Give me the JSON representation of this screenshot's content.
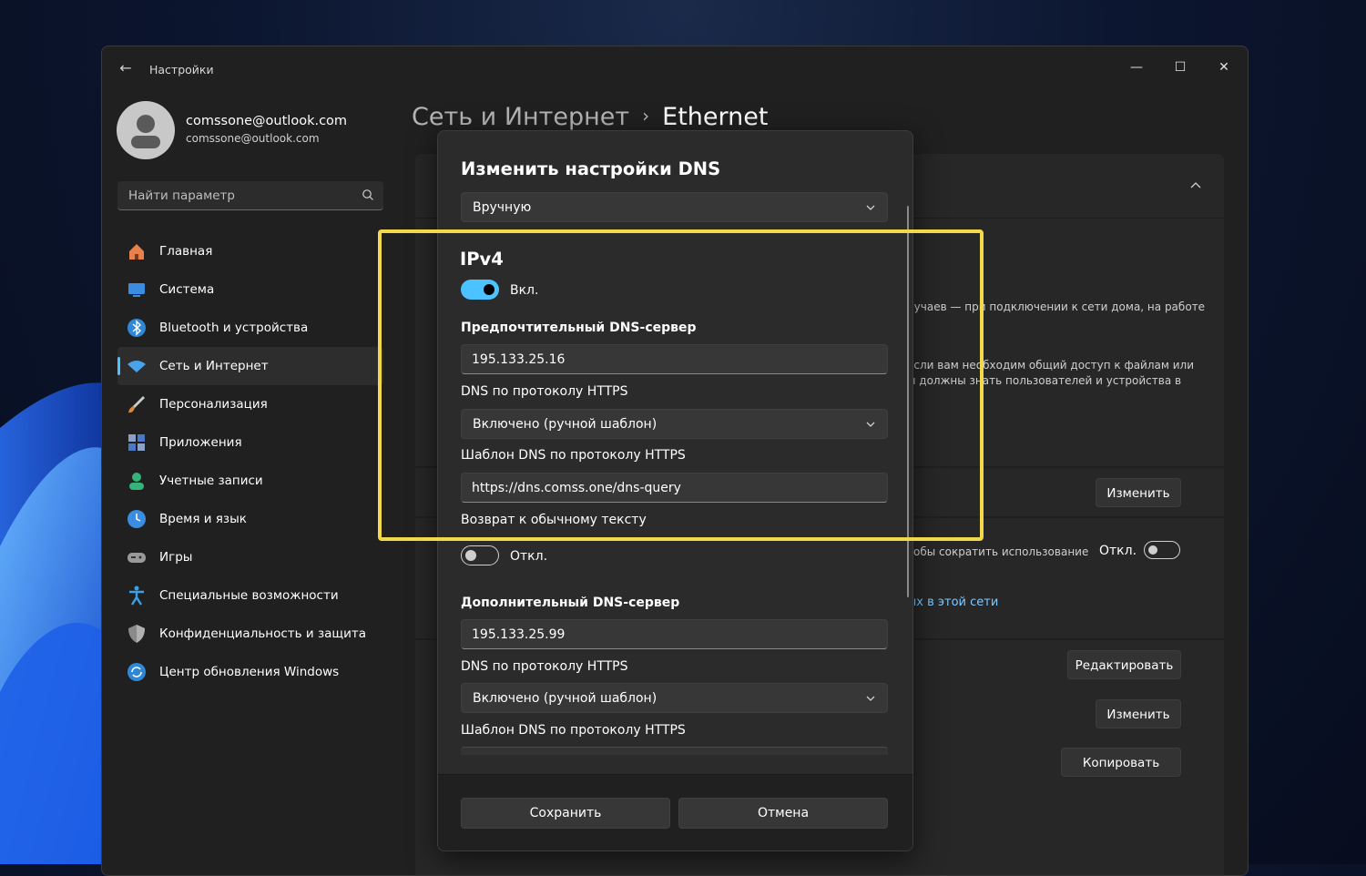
{
  "window": {
    "app_title": "Настройки",
    "controls": {
      "minimize": "—",
      "maximize": "☐",
      "close": "✕"
    }
  },
  "profile": {
    "name": "comssone@outlook.com",
    "email": "comssone@outlook.com"
  },
  "search": {
    "placeholder": "Найти параметр"
  },
  "sidebar": {
    "items": [
      {
        "label": "Главная",
        "icon": "home-icon",
        "color": "#e8804b"
      },
      {
        "label": "Система",
        "icon": "system-icon",
        "color": "#3a8de0"
      },
      {
        "label": "Bluetooth и устройства",
        "icon": "bluetooth-icon",
        "color": "#2f87d8"
      },
      {
        "label": "Сеть и Интернет",
        "icon": "wifi-icon",
        "color": "#4aa3e8",
        "active": true
      },
      {
        "label": "Персонализация",
        "icon": "brush-icon",
        "color": "#d9893a"
      },
      {
        "label": "Приложения",
        "icon": "apps-icon",
        "color": "#8aa0c8"
      },
      {
        "label": "Учетные записи",
        "icon": "accounts-icon",
        "color": "#34b37a"
      },
      {
        "label": "Время и язык",
        "icon": "time-language-icon",
        "color": "#3a8de0"
      },
      {
        "label": "Игры",
        "icon": "gamepad-icon",
        "color": "#9a9a9a"
      },
      {
        "label": "Специальные возможности",
        "icon": "accessibility-icon",
        "color": "#3aa0e8"
      },
      {
        "label": "Конфиденциальность и защита",
        "icon": "shield-icon",
        "color": "#8a8a8a"
      },
      {
        "label": "Центр обновления Windows",
        "icon": "update-icon",
        "color": "#2f87d8"
      }
    ]
  },
  "breadcrumb": {
    "parent": "Сеть и Интернет",
    "separator": "›",
    "current": "Ethernet"
  },
  "background": {
    "text1": "лучаев — при подключении к сети дома, на работе",
    "text2": "если вам необходим общий доступ к файлам или",
    "text3": "ы должны знать пользователей и устройства в",
    "text4": "тобы сократить использование",
    "link1": "ых в этой сети",
    "metered_label": "Откл.",
    "btn_change1": "Изменить",
    "btn_edit": "Редактировать",
    "btn_change2": "Изменить",
    "btn_copy": "Копировать"
  },
  "dialog": {
    "title": "Изменить настройки DNS",
    "mode": "Вручную",
    "ipv4": {
      "title": "IPv4",
      "toggle_label": "Вкл.",
      "preferred_label": "Предпочтительный DNS-сервер",
      "preferred_value": "195.133.25.16",
      "doh_label": "DNS по протоколу HTTPS",
      "doh_value": "Включено (ручной шаблон)",
      "template_label": "Шаблон DNS по протоколу HTTPS",
      "template_value": "https://dns.comss.one/dns-query",
      "fallback_label": "Возврат к обычному тексту",
      "fallback_toggle": "Откл.",
      "alternate_label": "Дополнительный DNS-сервер",
      "alternate_value": "195.133.25.99",
      "doh2_label": "DNS по протоколу HTTPS",
      "doh2_value": "Включено (ручной шаблон)",
      "template2_label": "Шаблон DNS по протоколу HTTPS"
    },
    "save": "Сохранить",
    "cancel": "Отмена"
  },
  "colors": {
    "accent": "#4cc2ff",
    "highlight": "#f3d84a",
    "dialog_bg": "#2b2b2b",
    "window_bg": "#202020"
  }
}
